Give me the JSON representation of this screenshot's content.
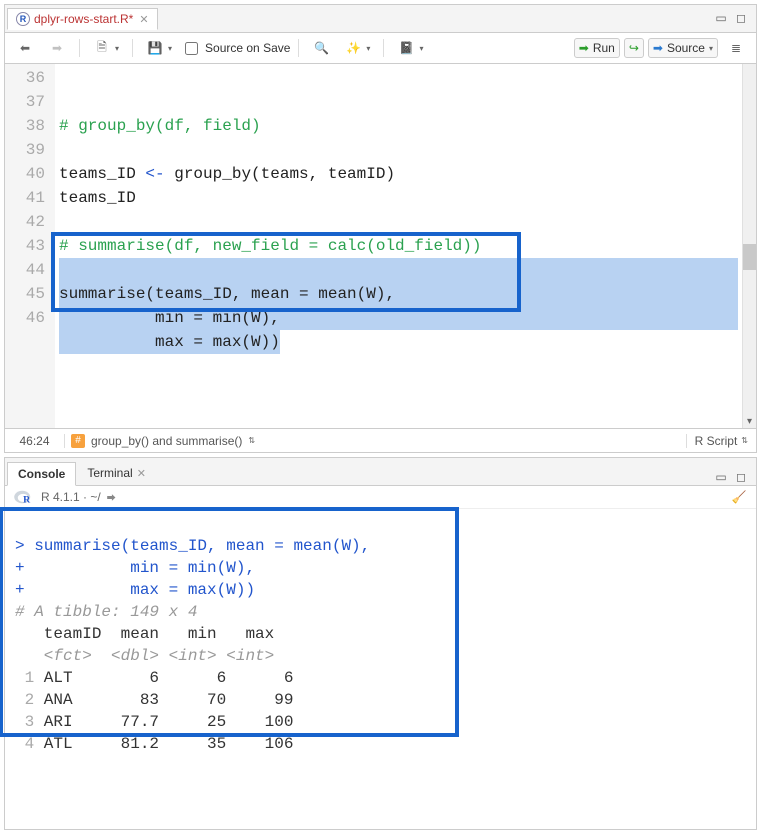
{
  "editor": {
    "file_tab": {
      "name": "dplyr-rows-start.R*",
      "icon": "R"
    },
    "toolbar": {
      "source_on_save": "Source on Save",
      "run": "Run",
      "source": "Source"
    },
    "gutter": [
      "36",
      "37",
      "38",
      "39",
      "40",
      "41",
      "42",
      "43",
      "44",
      "45",
      "46"
    ],
    "lines": {
      "l37_comment": "# group_by(df, field)",
      "l39_pre": "teams_ID ",
      "l39_op": "<-",
      "l39_post": " group_by(teams, teamID)",
      "l40": "teams_ID",
      "l42_comment": "# summarise(df, new_field = calc(old_field))",
      "l44": "summarise(teams_ID, mean = mean(W),",
      "l45": "          min = min(W),",
      "l46": "          max = max(W))"
    },
    "status": {
      "pos": "46:24",
      "scope": "group_by() and summarise()",
      "lang": "R Script"
    }
  },
  "console": {
    "tabs": {
      "console": "Console",
      "terminal": "Terminal"
    },
    "session": "R 4.1.1 · ~/",
    "cmd1": "summarise(teams_ID, mean = mean(W),",
    "cmd2": "          min = min(W),",
    "cmd3": "          max = max(W))",
    "tibble": "# A tibble: 149 x 4",
    "hdr": "   teamID  mean   min   max",
    "types": "   <fct>  <dbl> <int> <int>",
    "rows": [
      {
        "n": "1",
        "team": "ALT",
        "mean": "6",
        "min": "6",
        "max": "6"
      },
      {
        "n": "2",
        "team": "ANA",
        "mean": "83",
        "min": "70",
        "max": "99"
      },
      {
        "n": "3",
        "team": "ARI",
        "mean": "77.7",
        "min": "25",
        "max": "100"
      },
      {
        "n": "4",
        "team": "ATL",
        "mean": "81.2",
        "min": "35",
        "max": "106"
      }
    ]
  },
  "chart_data": {
    "type": "table",
    "title": "summarise(teams_ID, mean = mean(W), min = min(W), max = max(W))",
    "columns": [
      "teamID",
      "mean",
      "min",
      "max"
    ],
    "column_types": [
      "fct",
      "dbl",
      "int",
      "int"
    ],
    "nrow_total": 149,
    "ncol": 4,
    "rows_shown": [
      {
        "teamID": "ALT",
        "mean": 6,
        "min": 6,
        "max": 6
      },
      {
        "teamID": "ANA",
        "mean": 83,
        "min": 70,
        "max": 99
      },
      {
        "teamID": "ARI",
        "mean": 77.7,
        "min": 25,
        "max": 100
      },
      {
        "teamID": "ATL",
        "mean": 81.2,
        "min": 35,
        "max": 106
      }
    ]
  }
}
